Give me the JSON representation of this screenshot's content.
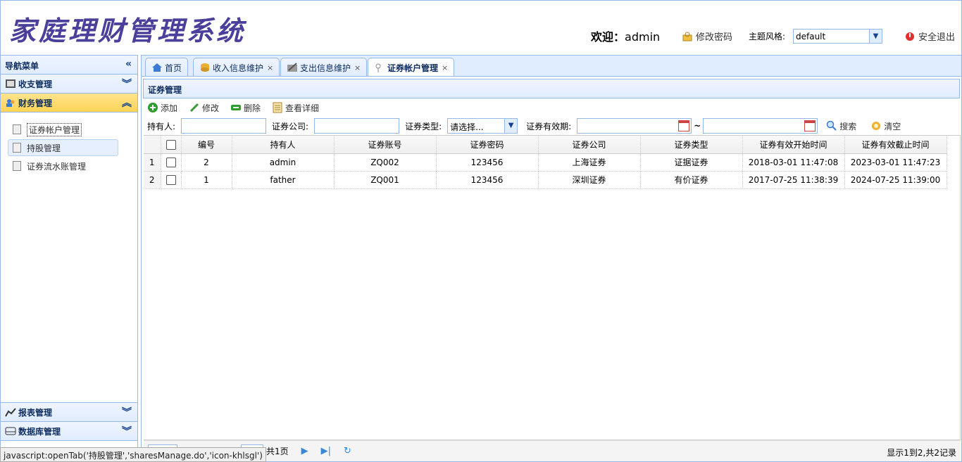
{
  "header": {
    "logo": "家庭理财管理系统",
    "welcome_prefix": "欢迎：",
    "username": "admin",
    "change_password": "修改密码",
    "theme_label": "主题风格:",
    "theme_value": "default",
    "logout": "安全退出"
  },
  "nav": {
    "title": "导航菜单",
    "groups": [
      {
        "label": "收支管理"
      },
      {
        "label": "财务管理"
      },
      {
        "label": "报表管理"
      },
      {
        "label": "数据库管理"
      }
    ],
    "items": [
      {
        "label": "证券帐户管理"
      },
      {
        "label": "持股管理"
      },
      {
        "label": "证券流水账管理"
      }
    ]
  },
  "tabs": [
    {
      "label": "首页"
    },
    {
      "label": "收入信息维护"
    },
    {
      "label": "支出信息维护"
    },
    {
      "label": "证券帐户管理"
    }
  ],
  "panel": {
    "title": "证券管理"
  },
  "toolbar": {
    "add": "添加",
    "edit": "修改",
    "delete": "删除",
    "detail": "查看详细"
  },
  "filter": {
    "holder": "持有人:",
    "company": "证券公司:",
    "type": "证券类型:",
    "type_value": "请选择...",
    "validity": "证券有效期:",
    "tilde": "~",
    "search": "搜索",
    "clear": "清空"
  },
  "table": {
    "columns": [
      "编号",
      "持有人",
      "证券账号",
      "证券密码",
      "证券公司",
      "证券类型",
      "证券有效开始时间",
      "证券有效截止时间"
    ],
    "rows": [
      {
        "rn": "1",
        "id": "2",
        "holder": "admin",
        "account": "ZQ002",
        "password": "123456",
        "company": "上海证券",
        "type": "证据证券",
        "start": "2018-03-01 11:47:08",
        "end": "2023-03-01 11:47:23"
      },
      {
        "rn": "2",
        "id": "1",
        "holder": "father",
        "account": "ZQ001",
        "password": "123456",
        "company": "深圳证券",
        "type": "有价证券",
        "start": "2017-07-25 11:38:39",
        "end": "2024-07-25 11:39:00"
      }
    ]
  },
  "pager": {
    "total_pages": "共1页",
    "info": "显示1到2,共2记录"
  },
  "status_bar": {
    "text": "javascript:openTab('持股管理','sharesManage.do','icon-khlsgl')"
  }
}
